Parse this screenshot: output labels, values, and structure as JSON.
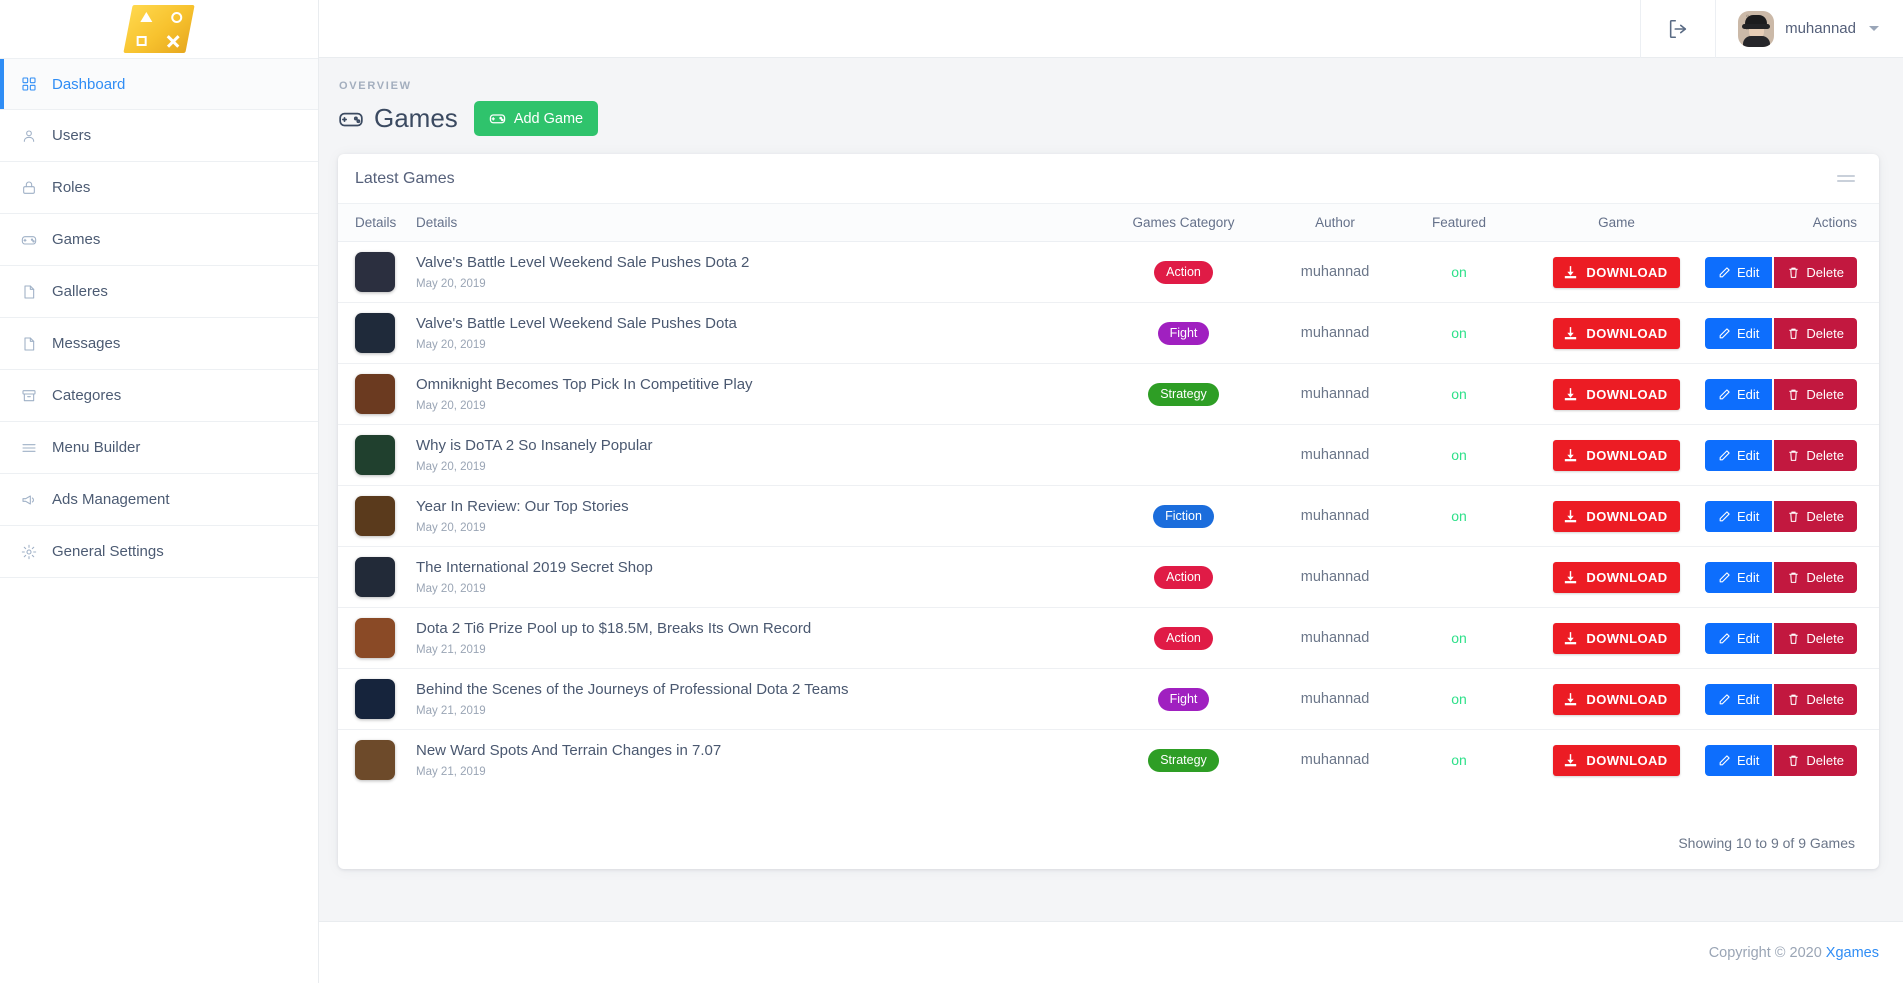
{
  "brand": {
    "logo_name": "xgames-logo",
    "symbols": [
      "triangle",
      "circle",
      "square",
      "x"
    ]
  },
  "sidebar": {
    "items": [
      {
        "label": "Dashboard",
        "icon": "grid-icon",
        "active": true
      },
      {
        "label": "Users",
        "icon": "user-icon",
        "active": false
      },
      {
        "label": "Roles",
        "icon": "lock-icon",
        "active": false
      },
      {
        "label": "Games",
        "icon": "gamepad-icon",
        "active": false
      },
      {
        "label": "Galleres",
        "icon": "document-icon",
        "active": false
      },
      {
        "label": "Messages",
        "icon": "document-icon",
        "active": false
      },
      {
        "label": "Categores",
        "icon": "archive-icon",
        "active": false
      },
      {
        "label": "Menu Builder",
        "icon": "menu-lines-icon",
        "active": false
      },
      {
        "label": "Ads Management",
        "icon": "megaphone-icon",
        "active": false
      },
      {
        "label": "General Settings",
        "icon": "gear-icon",
        "active": false
      }
    ]
  },
  "topbar": {
    "logout_icon": "logout-icon",
    "user_name": "muhannad",
    "avatar_tag": "mumo"
  },
  "page": {
    "overview_label": "OVERVIEW",
    "title": "Games",
    "title_icon": "gamepad-icon",
    "add_button": "Add Game",
    "add_button_icon": "gamepad-icon",
    "accent_green": "#2fc36c"
  },
  "card": {
    "title": "Latest Games",
    "minimize_icon": "minimize-icon",
    "columns": [
      "Details",
      "Details",
      "Games Category",
      "Author",
      "Featured",
      "Game",
      "Actions"
    ],
    "download_label": "DOWNLOAD",
    "edit_label": "Edit",
    "delete_label": "Delete",
    "showing": "Showing 10 to 9 of 9 Games",
    "rows": [
      {
        "title": "Valve's Battle Level Weekend Sale Pushes Dota 2",
        "date": "May 20, 2019",
        "category": "Action",
        "category_color": "#e01b46",
        "author": "muhannad",
        "featured": "on",
        "thumb": "#2b2f3f"
      },
      {
        "title": "Valve's Battle Level Weekend Sale Pushes Dota",
        "date": "May 20, 2019",
        "category": "Fight",
        "category_color": "#a020c0",
        "author": "muhannad",
        "featured": "on",
        "thumb": "#1f2a3a"
      },
      {
        "title": "Omniknight Becomes Top Pick In Competitive Play",
        "date": "May 20, 2019",
        "category": "Strategy",
        "category_color": "#2e9e25",
        "author": "muhannad",
        "featured": "on",
        "thumb": "#6b3a20"
      },
      {
        "title": "Why is DoTA 2 So Insanely Popular",
        "date": "May 20, 2019",
        "category": "",
        "category_color": "",
        "author": "muhannad",
        "featured": "on",
        "thumb": "#20402e"
      },
      {
        "title": "Year In Review: Our Top Stories",
        "date": "May 20, 2019",
        "category": "Fiction",
        "category_color": "#1b6ddc",
        "author": "muhannad",
        "featured": "on",
        "thumb": "#5a3a1c"
      },
      {
        "title": "The International 2019 Secret Shop",
        "date": "May 20, 2019",
        "category": "Action",
        "category_color": "#e01b46",
        "author": "muhannad",
        "featured": "",
        "thumb": "#222a38"
      },
      {
        "title": "Dota 2 Ti6 Prize Pool up to $18.5M, Breaks Its Own Record",
        "date": "May 21, 2019",
        "category": "Action",
        "category_color": "#e01b46",
        "author": "muhannad",
        "featured": "on",
        "thumb": "#8a4a26"
      },
      {
        "title": "Behind the Scenes of the Journeys of Professional Dota 2 Teams",
        "date": "May 21, 2019",
        "category": "Fight",
        "category_color": "#a020c0",
        "author": "muhannad",
        "featured": "on",
        "thumb": "#16243c"
      },
      {
        "title": "New Ward Spots And Terrain Changes in 7.07",
        "date": "May 21, 2019",
        "category": "Strategy",
        "category_color": "#2e9e25",
        "author": "muhannad",
        "featured": "on",
        "thumb": "#6d4a2a"
      }
    ]
  },
  "footer": {
    "copyright": "Copyright © 2020",
    "brand_link": "Xgames"
  }
}
